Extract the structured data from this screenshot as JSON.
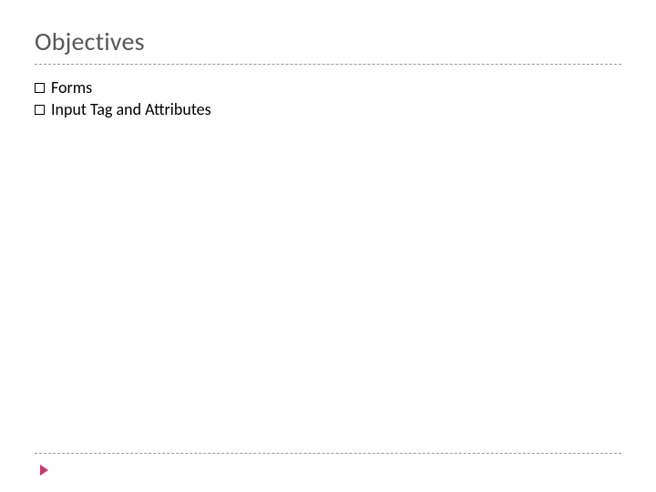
{
  "title": "Objectives",
  "bullets": [
    "Forms",
    "Input Tag and Attributes"
  ],
  "accent_color": "#c33a66"
}
